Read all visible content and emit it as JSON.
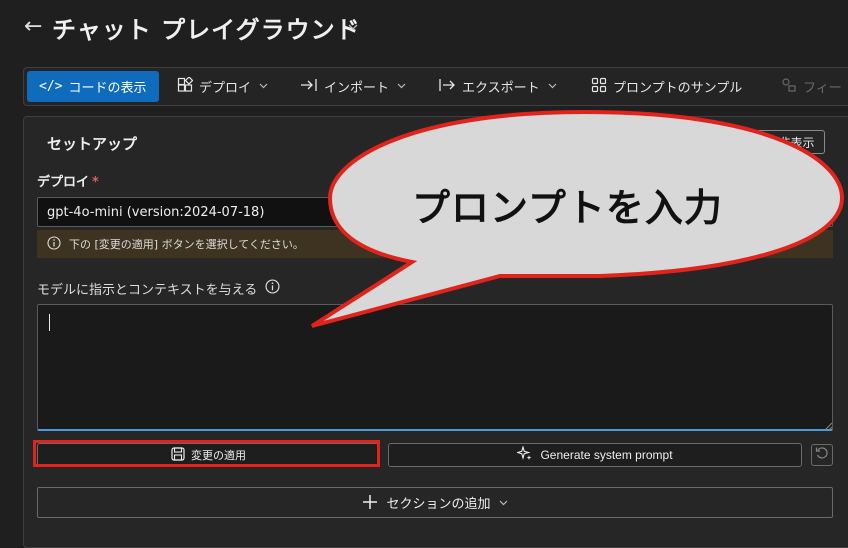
{
  "header": {
    "title": "チャット プレイグラウンド",
    "back_icon": "←",
    "chevron": "⌵"
  },
  "toolbar": {
    "view_code": "コードの表示",
    "deploy": "デプロイ",
    "import": "インポート",
    "export": "エクスポート",
    "prompt_samples": "プロンプトのサンプル",
    "features": "フィー"
  },
  "setup": {
    "title": "セットアップ",
    "hide_button": "非表示",
    "deploy_label": "デプロイ",
    "required_mark": "*",
    "deploy_value": "gpt-4o-mini (version:2024-07-18)",
    "warning_text": "下の [変更の適用] ボタンを選択してください。",
    "model_instructions_label": "モデルに指示とコンテキストを与える",
    "apply_button": "変更の適用",
    "generate_button": "Generate system prompt",
    "add_section": "セクションの追加"
  },
  "annotation": {
    "callout_text": "プロンプトを入力"
  },
  "colors": {
    "accent": "#0f6cbd",
    "highlight": "#e0241b",
    "warning_bg": "#3d3320",
    "background": "#1f1f1f"
  }
}
